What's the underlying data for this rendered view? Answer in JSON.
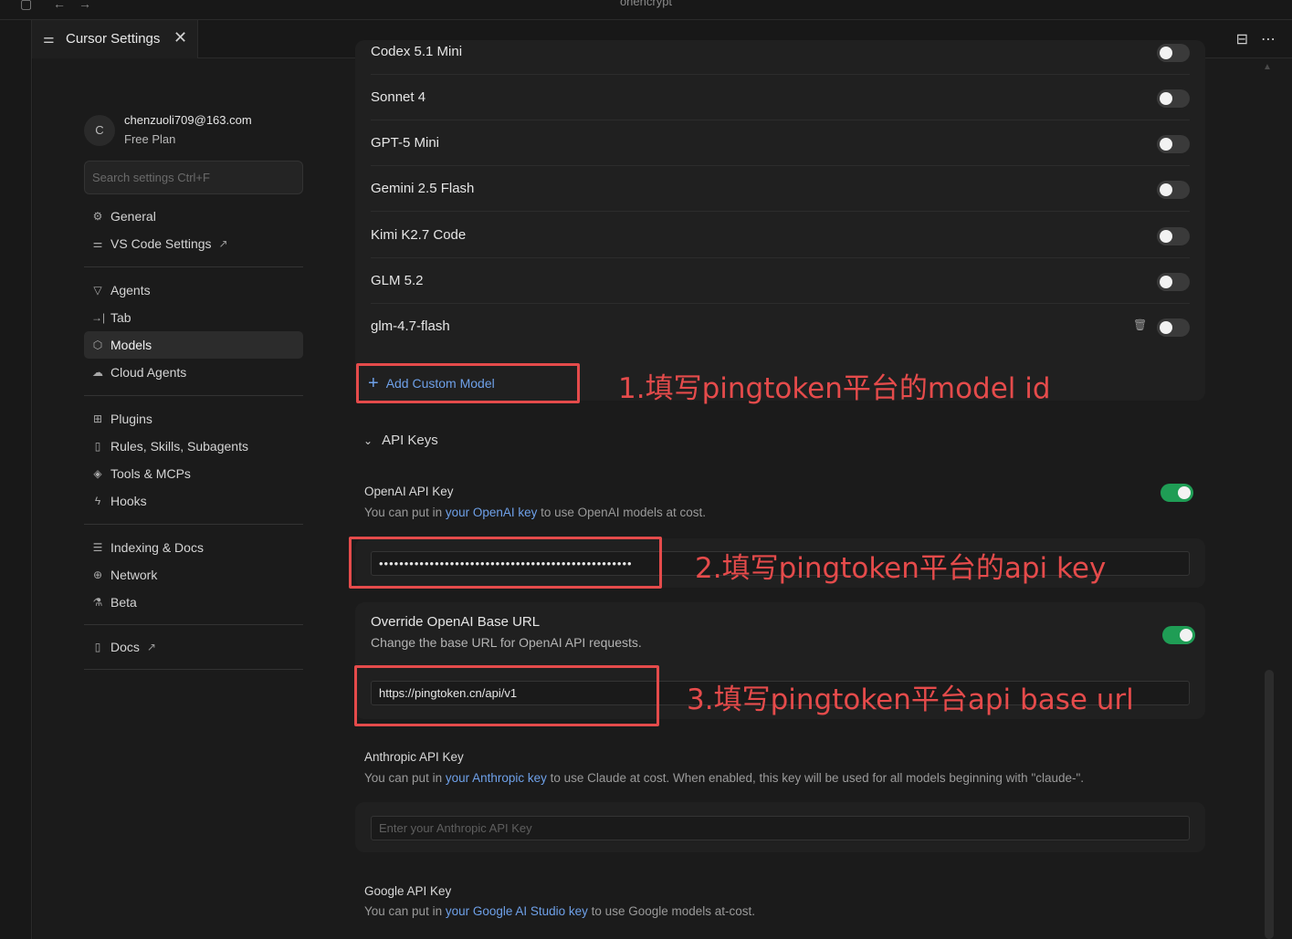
{
  "window": {
    "title": "onencrypt"
  },
  "tab": {
    "label": "Cursor Settings",
    "icon": "sliders-icon",
    "close_icon": "close-icon"
  },
  "tab_actions": [
    "split-editor-icon",
    "more-icon"
  ],
  "account": {
    "avatar_letter": "C",
    "email": "chenzuoli709@163.com",
    "plan": "Free Plan"
  },
  "search": {
    "placeholder": "Search settings Ctrl+F",
    "value": ""
  },
  "nav": {
    "group1": [
      {
        "label": "General",
        "icon": "gear-icon"
      },
      {
        "label": "VS Code Settings",
        "icon": "vscode-settings-icon",
        "external": "↗"
      }
    ],
    "group2": [
      {
        "label": "Agents",
        "icon": "agents-icon"
      },
      {
        "label": "Tab",
        "icon": "tab-arrow-icon"
      },
      {
        "label": "Models",
        "icon": "cube-icon",
        "active": true
      },
      {
        "label": "Cloud Agents",
        "icon": "cloud-icon"
      }
    ],
    "group3": [
      {
        "label": "Plugins",
        "icon": "plugin-icon"
      },
      {
        "label": "Rules, Skills, Subagents",
        "icon": "book-icon"
      },
      {
        "label": "Tools & MCPs",
        "icon": "tools-icon"
      },
      {
        "label": "Hooks",
        "icon": "bolt-icon"
      }
    ],
    "group4": [
      {
        "label": "Indexing & Docs",
        "icon": "database-icon"
      },
      {
        "label": "Network",
        "icon": "globe-icon"
      },
      {
        "label": "Beta",
        "icon": "flask-icon"
      }
    ],
    "group5": [
      {
        "label": "Docs",
        "icon": "book-icon",
        "external": "↗"
      }
    ]
  },
  "models": [
    {
      "name": "Codex 5.1 Mini",
      "enabled": false
    },
    {
      "name": "Sonnet 4",
      "enabled": false
    },
    {
      "name": "GPT-5 Mini",
      "enabled": false
    },
    {
      "name": "Gemini 2.5 Flash",
      "enabled": false
    },
    {
      "name": "Kimi K2.7 Code",
      "enabled": false
    },
    {
      "name": "GLM 5.2",
      "enabled": false
    },
    {
      "name": "glm-4.7-flash",
      "enabled": false,
      "deletable": true
    }
  ],
  "add_custom_model": {
    "label": "Add Custom Model",
    "icon": "plus-icon"
  },
  "api_keys": {
    "heading": "API Keys",
    "openai": {
      "title": "OpenAI API Key",
      "desc_prefix": "You can put in ",
      "desc_link": "your OpenAI key",
      "desc_suffix": " to use OpenAI models at cost.",
      "enabled": true,
      "value": "••••••••••••••••••••••••••••••••••••••••••••••••••"
    },
    "override": {
      "title": "Override OpenAI Base URL",
      "desc": "Change the base URL for OpenAI API requests.",
      "enabled": true,
      "value": "https://pingtoken.cn/api/v1"
    },
    "anthropic": {
      "title": "Anthropic API Key",
      "desc_prefix": "You can put in ",
      "desc_link": "your Anthropic key",
      "desc_suffix": " to use Claude at cost. When enabled, this key will be used for all models beginning with \"claude-\".",
      "placeholder": "Enter your Anthropic API Key"
    },
    "google": {
      "title": "Google API Key",
      "desc_prefix": "You can put in ",
      "desc_link": "your Google AI Studio key",
      "desc_suffix": " to use Google models at-cost."
    }
  },
  "annotations": {
    "note1": "1.填写pingtoken平台的model id",
    "note2": "2.填写pingtoken平台的api key",
    "note3": "3.填写pingtoken平台api base url",
    "color": "#e54b4b"
  },
  "colors": {
    "accent": "#6ea0e8",
    "toggle_on": "#1f9d55",
    "annotation": "#e54b4b"
  }
}
